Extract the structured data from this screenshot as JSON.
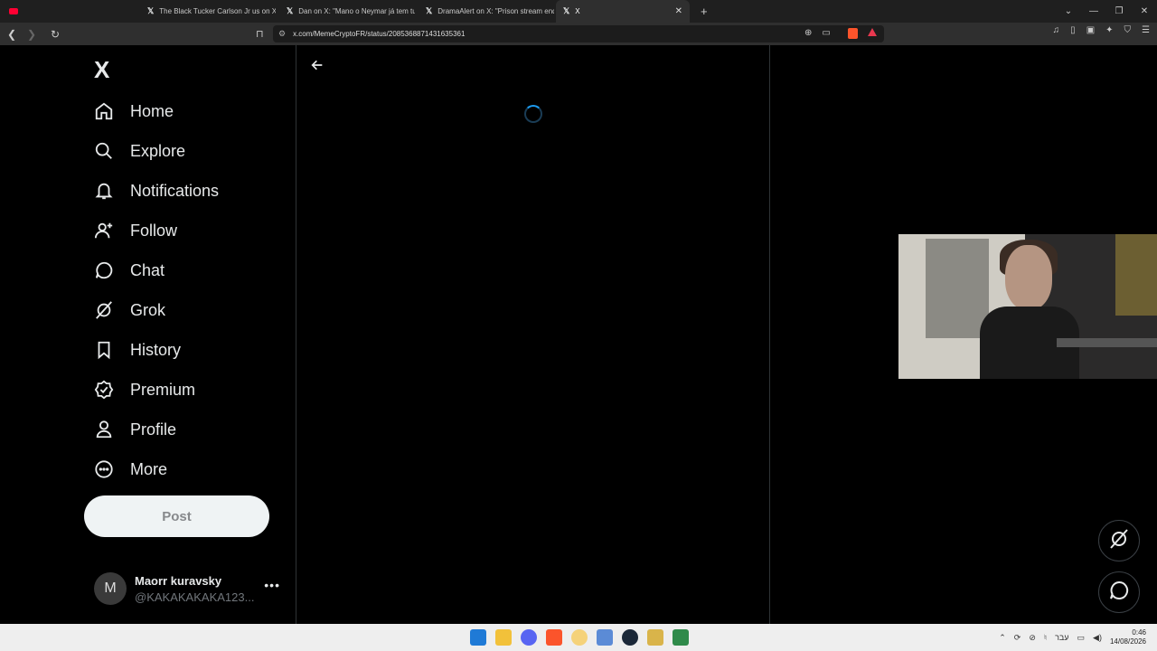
{
  "browser": {
    "tabs": [
      {
        "label": "",
        "type": "youtube"
      },
      {
        "label": "The Black Tucker Carlson Jr us on X: \""
      },
      {
        "label": "Dan on X: \"Mano o Neymar já tem tu"
      },
      {
        "label": "DramaAlert on X: \"Prison stream end"
      },
      {
        "label": "X",
        "active": true
      }
    ],
    "url": "x.com/MemeCryptoFR/status/2085368871431635361"
  },
  "sidebar": {
    "logo": "X",
    "items": [
      {
        "label": "Home",
        "icon": "home-icon"
      },
      {
        "label": "Explore",
        "icon": "search-icon"
      },
      {
        "label": "Notifications",
        "icon": "bell-icon"
      },
      {
        "label": "Follow",
        "icon": "add-user-icon"
      },
      {
        "label": "Chat",
        "icon": "chat-icon"
      },
      {
        "label": "Grok",
        "icon": "grok-icon"
      },
      {
        "label": "History",
        "icon": "bookmark-icon"
      },
      {
        "label": "Premium",
        "icon": "verified-icon"
      },
      {
        "label": "Profile",
        "icon": "person-icon"
      },
      {
        "label": "More",
        "icon": "more-circle-icon"
      }
    ],
    "post_label": "Post",
    "account": {
      "initial": "M",
      "name": "Maorr kuravsky",
      "handle": "@KAKAKAKAKA123..."
    }
  },
  "taskbar": {
    "lang": "עבר",
    "time": "0:46",
    "date": "14/08/2026"
  },
  "colors": {
    "accent": "#1d9bf0",
    "background": "#000000",
    "text": "#e7e9ea",
    "muted": "#71767b"
  }
}
